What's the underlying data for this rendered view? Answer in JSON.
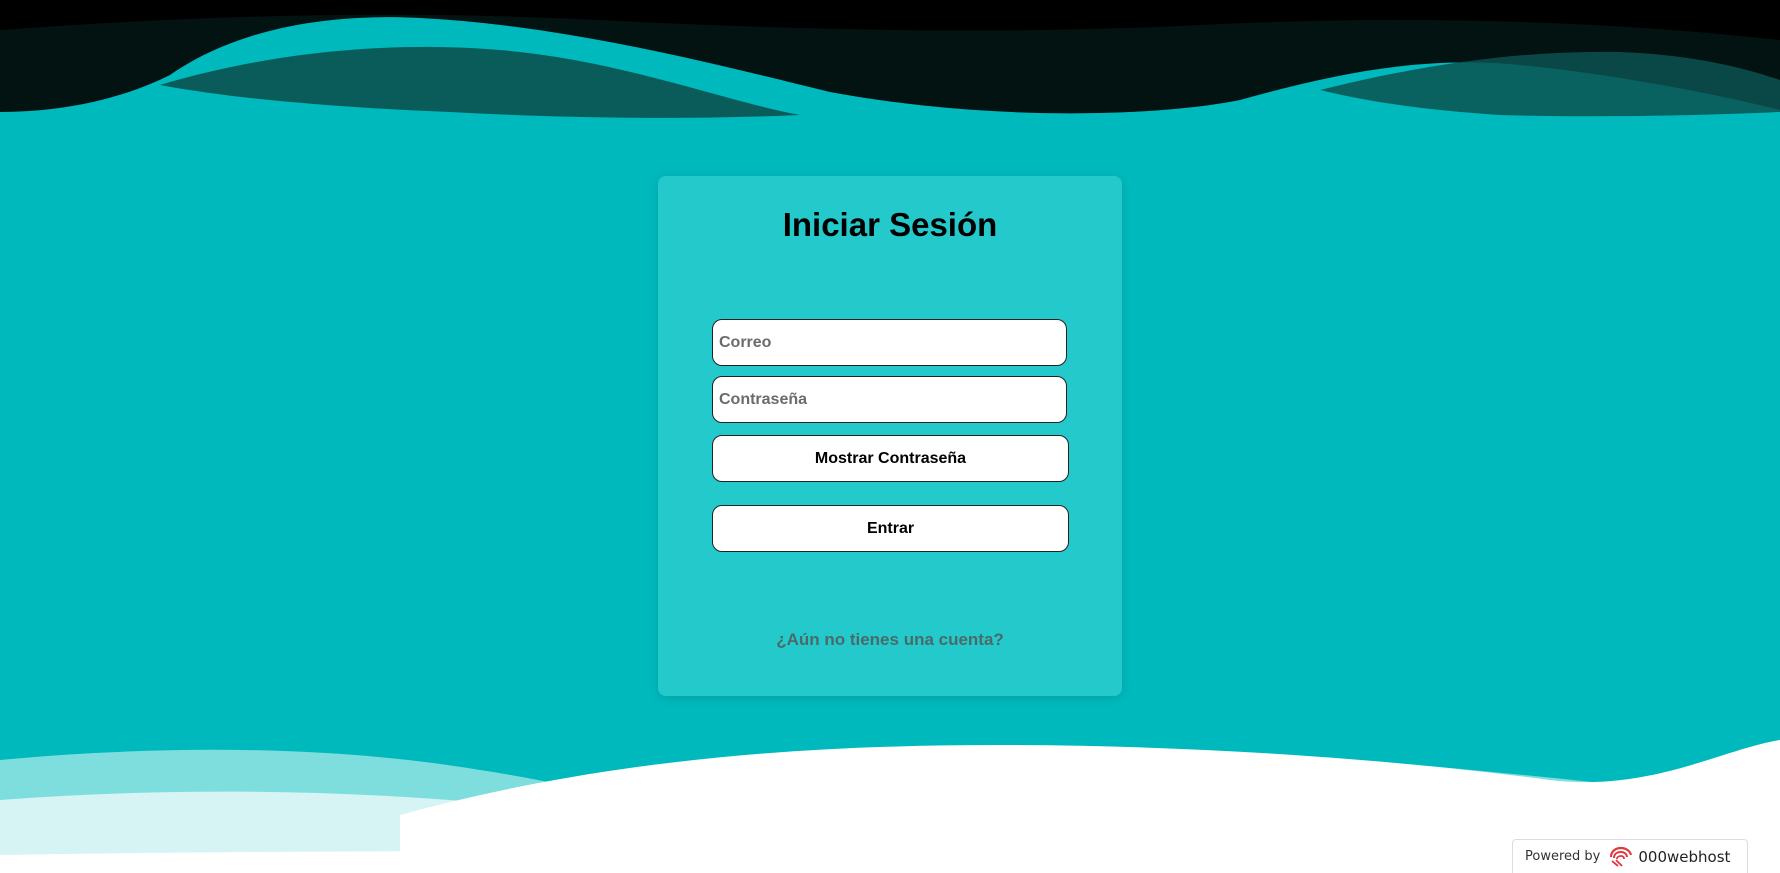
{
  "login": {
    "title": "Iniciar Sesión",
    "email_placeholder": "Correo",
    "password_placeholder": "Contraseña",
    "show_password_label": "Mostrar Contraseña",
    "submit_label": "Entrar",
    "signup_link": "¿Aún no tienes una cuenta?"
  },
  "footer": {
    "powered_by": "Powered by",
    "host_name": "000webhost"
  },
  "colors": {
    "background": "#00b9bd",
    "card": "#24cacb",
    "top_wave": "#000000",
    "bottom_wave": "#ffffff",
    "host_logo": "#e0393e"
  }
}
